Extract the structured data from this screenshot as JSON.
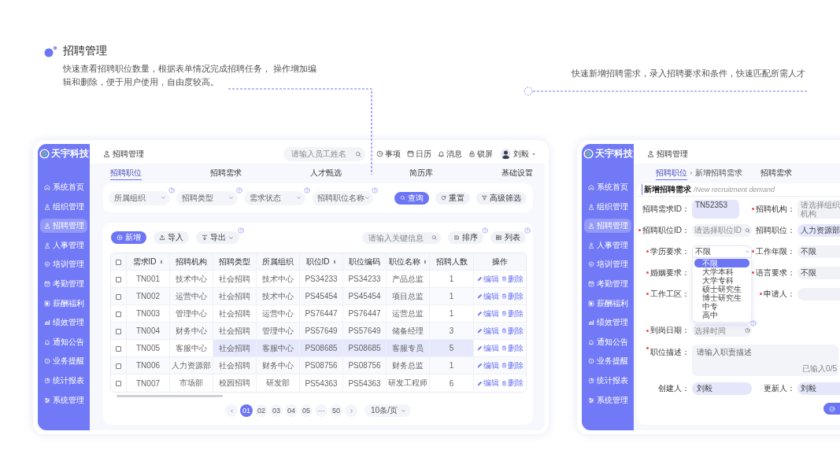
{
  "intro_left": {
    "title": "招聘管理",
    "description": "快速查看招聘职位数量，根据表单情况完成招聘任务， 操作增加编辑和删除，便于用户使用，自由度较高。"
  },
  "intro_right": {
    "description": "快速新增招聘需求，录入招聘要求和条件，快速匹配所需人才"
  },
  "list_screen": {
    "logo": "天宇科技",
    "sidebar": {
      "items": [
        {
          "label": "系统首页",
          "selected": false
        },
        {
          "label": "组织管理",
          "selected": false
        },
        {
          "label": "招聘管理",
          "selected": true
        },
        {
          "label": "人事管理",
          "selected": false
        },
        {
          "label": "培训管理",
          "selected": false
        },
        {
          "label": "考勤管理",
          "selected": false
        },
        {
          "label": "薪酬福利",
          "selected": false
        },
        {
          "label": "绩效管理",
          "selected": false
        },
        {
          "label": "通知公告",
          "selected": false
        },
        {
          "label": "业务提醒",
          "selected": false
        },
        {
          "label": "统计报表",
          "selected": false
        },
        {
          "label": "系统管理",
          "selected": false
        }
      ]
    },
    "header": {
      "title": "招聘管理",
      "search_placeholder": "请输入员工姓名",
      "actions": [
        "事项",
        "日历",
        "消息",
        "锁屏"
      ],
      "user": "刘毅"
    },
    "tabs": [
      {
        "label": "招聘职位",
        "selected": true
      },
      {
        "label": "招聘需求",
        "selected": false
      },
      {
        "label": "人才甄选",
        "selected": false
      },
      {
        "label": "简历库",
        "selected": false
      },
      {
        "label": "基础设置",
        "selected": false
      }
    ],
    "filters": [
      {
        "placeholder": "所属组织",
        "help": true
      },
      {
        "placeholder": "招聘类型",
        "help": true
      },
      {
        "placeholder": "需求状态",
        "help": true
      },
      {
        "placeholder": "招聘职位名称",
        "help": true
      }
    ],
    "filter_buttons": [
      {
        "label": "查询",
        "kind": "primary"
      },
      {
        "label": "重置",
        "kind": "reset"
      },
      {
        "label": "高级筛选",
        "kind": "filter"
      }
    ],
    "toolbar": [
      {
        "label": "新增",
        "kind": "add",
        "help": false
      },
      {
        "label": "导入",
        "kind": "import",
        "help": false
      },
      {
        "label": "导出",
        "kind": "export",
        "help": true
      }
    ],
    "table_search_placeholder": "请输入关键信息",
    "view_buttons": [
      {
        "label": "排序",
        "kind": "sort",
        "help": true
      },
      {
        "label": "列表",
        "kind": "list",
        "help": true
      }
    ],
    "table": {
      "header_checked": false,
      "columns": [
        {
          "label": "需求ID",
          "sortable": true
        },
        {
          "label": "招聘机构",
          "sortable": false
        },
        {
          "label": "招聘类型",
          "sortable": false
        },
        {
          "label": "所属组织",
          "sortable": false
        },
        {
          "label": "职位ID",
          "sortable": true
        },
        {
          "label": "职位编码",
          "sortable": false
        },
        {
          "label": "职位名称",
          "sortable": true
        },
        {
          "label": "招聘人数",
          "sortable": false
        },
        {
          "label": "操作",
          "sortable": false
        }
      ],
      "rows": [
        {
          "checked": false,
          "selected": false,
          "cells": [
            "TN001",
            "技术中心",
            "社会招聘",
            "技术中心",
            "PS34233",
            "PS34233",
            "产品总监",
            "1"
          ],
          "actions": [
            "编辑",
            "删除"
          ]
        },
        {
          "checked": false,
          "selected": false,
          "cells": [
            "TN002",
            "运营中心",
            "社会招聘",
            "技术中心",
            "PS45454",
            "PS45454",
            "项目总监",
            "1"
          ],
          "actions": [
            "编辑",
            "删除"
          ]
        },
        {
          "checked": false,
          "selected": false,
          "cells": [
            "TN003",
            "管理中心",
            "社会招聘",
            "运营中心",
            "PS76447",
            "PS76447",
            "运营总监",
            "1"
          ],
          "actions": [
            "编辑",
            "删除"
          ]
        },
        {
          "checked": false,
          "selected": false,
          "cells": [
            "TN004",
            "财务中心",
            "社会招聘",
            "管理中心",
            "PS57649",
            "PS57649",
            "储备经理",
            "3"
          ],
          "actions": [
            "编辑",
            "删除"
          ]
        },
        {
          "checked": false,
          "selected": true,
          "cells": [
            "TN005",
            "客服中心",
            "社会招聘",
            "客服中心",
            "PS08685",
            "PS08685",
            "客服专员",
            "5"
          ],
          "actions": [
            "编辑",
            "删除"
          ]
        },
        {
          "checked": false,
          "selected": false,
          "cells": [
            "TN006",
            "人力资源部",
            "社会招聘",
            "财务中心",
            "PS08756",
            "PS08756",
            "财务总监",
            "1"
          ],
          "actions": [
            "编辑",
            "删除"
          ]
        },
        {
          "checked": false,
          "selected": false,
          "cells": [
            "TN007",
            "市场部",
            "校园招聘",
            "研发部",
            "PS54363",
            "PS54363",
            "研发工程师",
            "6"
          ],
          "actions": [
            "编辑",
            "删除"
          ]
        }
      ]
    },
    "pagination": {
      "pages": [
        {
          "label": "01",
          "selected": true
        },
        {
          "label": "02",
          "selected": false
        },
        {
          "label": "03",
          "selected": false
        },
        {
          "label": "04",
          "selected": false
        },
        {
          "label": "05",
          "selected": false
        },
        {
          "label": "···",
          "selected": false
        },
        {
          "label": "50",
          "selected": false
        }
      ],
      "page_size": "10条/页"
    }
  },
  "form_screen": {
    "logo": "天宇科技",
    "sidebar": {
      "items": [
        {
          "label": "系统首页",
          "selected": false
        },
        {
          "label": "组织管理",
          "selected": false
        },
        {
          "label": "招聘管理",
          "selected": true
        },
        {
          "label": "人事管理",
          "selected": false
        },
        {
          "label": "培训管理",
          "selected": false
        },
        {
          "label": "考勤管理",
          "selected": false
        },
        {
          "label": "薪酬福利",
          "selected": false
        },
        {
          "label": "绩效管理",
          "selected": false
        },
        {
          "label": "通知公告",
          "selected": false
        },
        {
          "label": "业务提醒",
          "selected": false
        },
        {
          "label": "统计报表",
          "selected": false
        },
        {
          "label": "系统管理",
          "selected": false
        }
      ]
    },
    "header": {
      "title": "招聘管理"
    },
    "tabs": [
      {
        "label": "招聘职位",
        "selected": true
      },
      {
        "label": "招聘需求",
        "selected": false
      }
    ],
    "breadcrumb_current": "新增招聘需求",
    "form": {
      "title": "新增招聘需求",
      "subtitle": "/New recruitment demand",
      "rows": [
        {
          "left": {
            "label": "招聘需求ID：",
            "required": false,
            "kind": "text",
            "value": "TN52353",
            "readonly": true
          },
          "right": {
            "label": "招聘机构：",
            "required": true,
            "kind": "text",
            "placeholder": "请选择组织机构",
            "readonly": false
          }
        },
        {
          "left": {
            "label": "招聘职位ID：",
            "required": true,
            "kind": "search",
            "placeholder": "请选择职位ID",
            "readonly": false
          },
          "right": {
            "label": "招聘职位：",
            "required": false,
            "kind": "text",
            "value": "人力资源部",
            "readonly": true
          }
        },
        {
          "left": {
            "label": "学历要求：",
            "required": true,
            "kind": "select",
            "value": "不限",
            "readonly": false,
            "open": true,
            "options": [
              {
                "label": "不限",
                "selected": true
              },
              {
                "label": "大学本科",
                "selected": false
              },
              {
                "label": "大学专科",
                "selected": false
              },
              {
                "label": "硕士研究生",
                "selected": false
              },
              {
                "label": "博士研究生",
                "selected": false
              },
              {
                "label": "中专",
                "selected": false
              },
              {
                "label": "高中",
                "selected": false
              }
            ]
          },
          "right": {
            "label": "工作年限：",
            "required": true,
            "kind": "text",
            "value": "不限",
            "readonly": false
          }
        },
        {
          "left": {
            "label": "婚姻要求：",
            "required": true,
            "kind": "covered"
          },
          "right": {
            "label": "语言要求：",
            "required": true,
            "kind": "text",
            "value": "不限",
            "readonly": false
          }
        },
        {
          "left": {
            "label": "工作工区：",
            "required": true,
            "kind": "covered"
          },
          "right": {
            "label": "申请人：",
            "required": true,
            "kind": "text",
            "readonly": false
          }
        },
        {
          "left": {
            "label": "到岗日期：",
            "required": true,
            "kind": "date",
            "placeholder": "选择时间",
            "readonly": false,
            "help": true
          }
        }
      ],
      "description": {
        "label": "职位描述：",
        "required": true,
        "placeholder": "请输入职责描述",
        "counter": "已输入0/5"
      },
      "footer": [
        {
          "label": "创建人：",
          "required": false,
          "kind": "text",
          "value": "刘毅",
          "readonly": true
        },
        {
          "label": "更新人：",
          "required": false,
          "kind": "text",
          "value": "刘毅",
          "readonly": true
        }
      ],
      "submit_button": {
        "kind": "confirm"
      }
    }
  }
}
